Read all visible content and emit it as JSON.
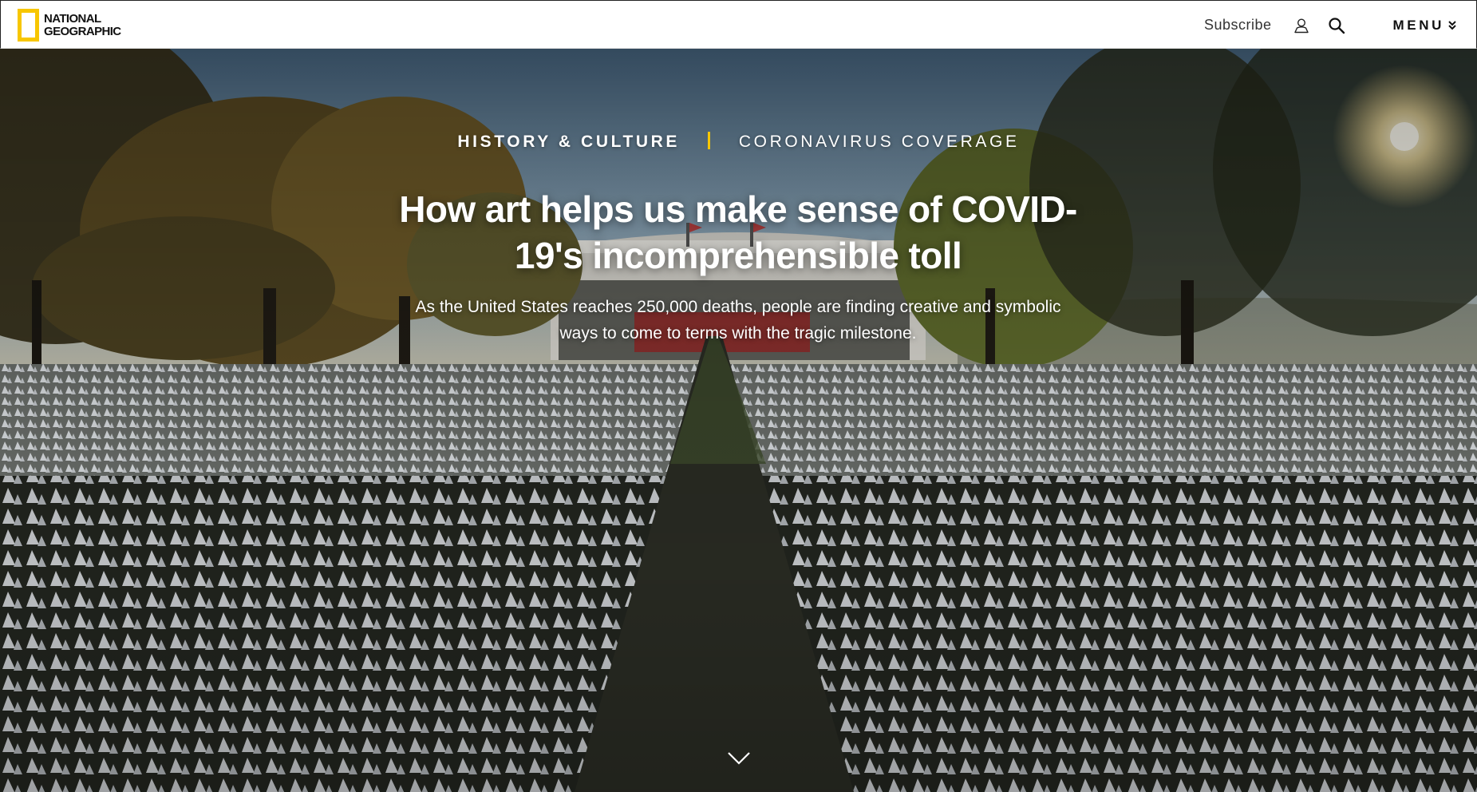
{
  "site": {
    "logo_line1": "NATIONAL",
    "logo_line2": "GEOGRAPHIC",
    "logo_color": "#f7c600"
  },
  "nav": {
    "subscribe": "Subscribe",
    "account_icon": "user-icon",
    "search_icon": "search-icon",
    "menu_label": "MENU",
    "menu_icon": "chevron-double-down-icon"
  },
  "article": {
    "category_primary": "HISTORY & CULTURE",
    "category_secondary": "CORONAVIRUS COVERAGE",
    "headline": "How art helps us make sense of COVID-19's incomprehensible toll",
    "dek": "As the United States reaches 250,000 deaths, people are finding creative and symbolic ways to come to terms with the tragic milestone.",
    "hero_image": "Field of white flags in front of a stadium at sunset",
    "scroll_icon": "chevron-down-icon"
  },
  "colors": {
    "accent": "#f7c600",
    "text_on_image": "#ffffff"
  }
}
